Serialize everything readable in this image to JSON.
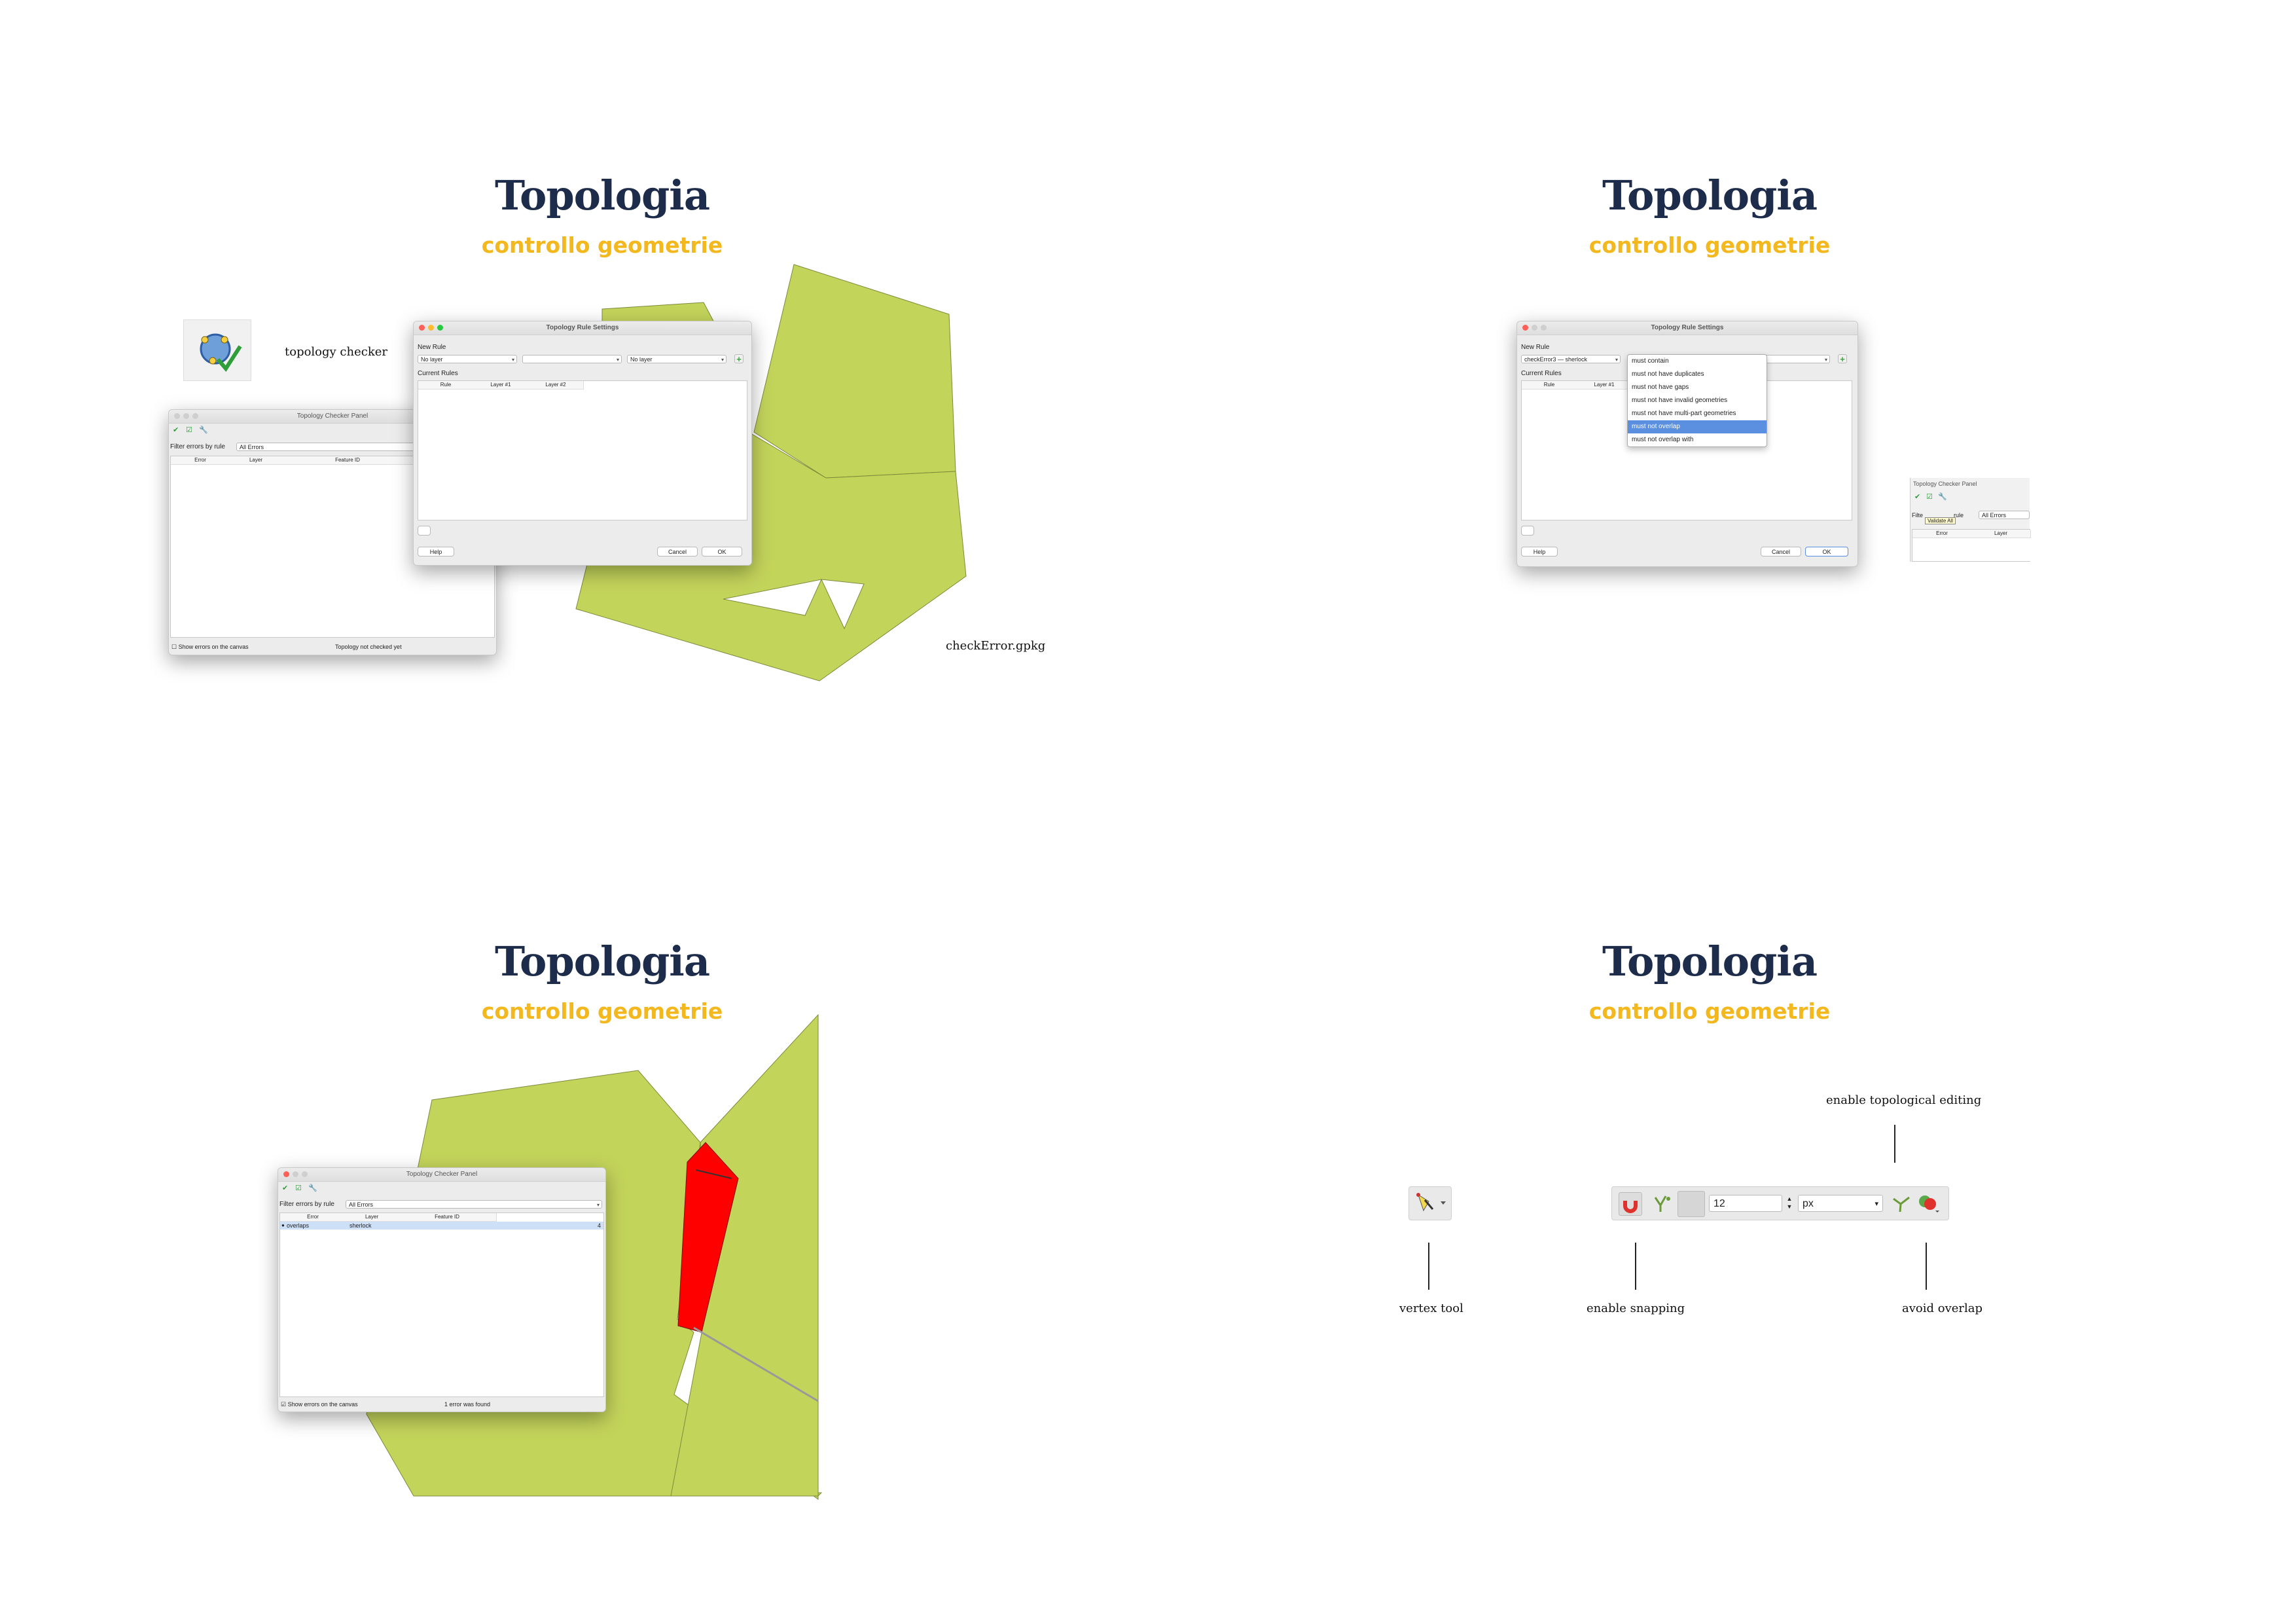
{
  "slides": [
    {
      "title": "Topologia",
      "subtitle": "controllo geometrie"
    },
    {
      "title": "Topologia",
      "subtitle": "controllo geometrie"
    },
    {
      "title": "Topologia",
      "subtitle": "controllo geometrie"
    },
    {
      "title": "Topologia",
      "subtitle": "controllo geometrie"
    }
  ],
  "captions": {
    "topology_checker": "topology checker",
    "check_error_file": "checkError.gpkg",
    "vertex_tool": "vertex tool",
    "enable_snapping": "enable snapping",
    "enable_topological_editing": "enable topological editing",
    "avoid_overlap": "avoid overlap"
  },
  "rule_settings": {
    "window_title": "Topology Rule Settings",
    "new_rule_label": "New Rule",
    "layer_combo_1": "No layer",
    "rule_combo": "",
    "layer_combo_2": "No layer",
    "current_rules_label": "Current Rules",
    "columns": [
      "Rule",
      "Layer #1",
      "Layer #2"
    ],
    "help_button": "Help",
    "cancel_button": "Cancel",
    "ok_button": "OK"
  },
  "rule_settings_2": {
    "window_title": "Topology Rule Settings",
    "new_rule_label": "New Rule",
    "layer_combo_1": "checkError3 — sherlock",
    "current_rules_label": "Current Rules",
    "columns": [
      "Rule",
      "Layer #1"
    ],
    "help_button": "Help",
    "cancel_button": "Cancel",
    "ok_button": "OK",
    "dropdown_options": [
      "must contain",
      "must not have duplicates",
      "must not have gaps",
      "must not have invalid geometries",
      "must not have multi-part geometries",
      "must not overlap",
      "must not overlap with"
    ],
    "selected_option": "must not overlap"
  },
  "checker_panel_1": {
    "window_title": "Topology Checker Panel",
    "filter_label": "Filter errors by rule",
    "filter_value": "All Errors",
    "columns": [
      "Error",
      "Layer",
      "Feature ID"
    ],
    "show_errors_label": "Show errors on the canvas",
    "status": "Topology not checked yet"
  },
  "checker_panel_2": {
    "window_title": "Topology Checker Panel",
    "filter_label_part1": "Filte",
    "filter_label_part2": "rule",
    "tooltip": "Validate All",
    "filter_value": "All Errors",
    "columns": [
      "Error",
      "Layer"
    ]
  },
  "checker_panel_3": {
    "window_title": "Topology Checker Panel",
    "filter_label": "Filter errors by rule",
    "filter_value": "All Errors",
    "columns": [
      "Error",
      "Layer",
      "Feature ID"
    ],
    "rows": [
      {
        "error": "overlaps",
        "layer": "sherlock",
        "feature_id": "4"
      }
    ],
    "show_errors_label": "Show errors on the canvas",
    "status": "1 error was found"
  },
  "snapping_toolbar": {
    "tolerance_value": "12",
    "units_value": "px"
  },
  "colors": {
    "title": "#1d2c4a",
    "subtitle": "#f4b81f",
    "polygon_fill": "#c3d45b",
    "polygon_stroke": "#7c8a3a",
    "error_fill": "#ff0000",
    "selection": "#5b8fe0"
  },
  "icons": [
    "topology-checker-icon",
    "vertex-tool-icon",
    "magnet-icon",
    "snap-settings-icon",
    "topological-editing-icon",
    "avoid-overlap-icon"
  ]
}
